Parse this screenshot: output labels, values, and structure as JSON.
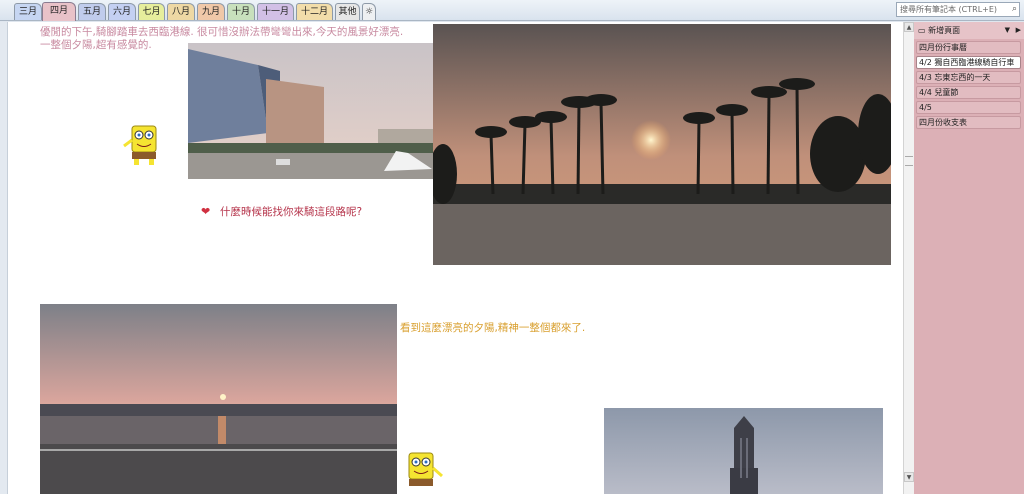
{
  "tabs": [
    {
      "label": "三月",
      "color": "#c6d6f2"
    },
    {
      "label": "四月",
      "color": "#e8c2c8",
      "active": true
    },
    {
      "label": "五月",
      "color": "#c0ccec"
    },
    {
      "label": "六月",
      "color": "#c4d0f2"
    },
    {
      "label": "七月",
      "color": "#e6ee9c"
    },
    {
      "label": "八月",
      "color": "#eed8a4"
    },
    {
      "label": "九月",
      "color": "#f0c8a8"
    },
    {
      "label": "十月",
      "color": "#c8e0bc"
    },
    {
      "label": "十一月",
      "color": "#d2c0e6"
    },
    {
      "label": "十二月",
      "color": "#f2ddaa"
    },
    {
      "label": "其他",
      "color": "#e6e6e6"
    },
    {
      "label": "☼",
      "color": "#eef0f2"
    }
  ],
  "search": {
    "placeholder": "搜尋所有筆記本 (CTRL+E)"
  },
  "sidebar": {
    "new_page": "新增頁面",
    "pages": [
      {
        "label": "四月份行事曆"
      },
      {
        "label": "4/2 獨自西臨港線騎自行車",
        "selected": true
      },
      {
        "label": "4/3 忘東忘西的一天"
      },
      {
        "label": "4/4 兒童節"
      },
      {
        "label": "4/5"
      },
      {
        "label": "四月份收支表"
      }
    ]
  },
  "content": {
    "para1": "優閒的下午,騎腳踏車去西臨港線. 很可惜沒辦法帶彎彎出來,今天的風景好漂亮. 一整個夕陽,超有感覺的.",
    "heart_text": "什麼時候能找你來騎這段路呢?",
    "para2": "看到這麼漂亮的夕陽,精神一整個都來了."
  },
  "colors": {
    "para1": "#c88aa0",
    "heart_text": "#b5334a",
    "para2": "#d9a030"
  }
}
